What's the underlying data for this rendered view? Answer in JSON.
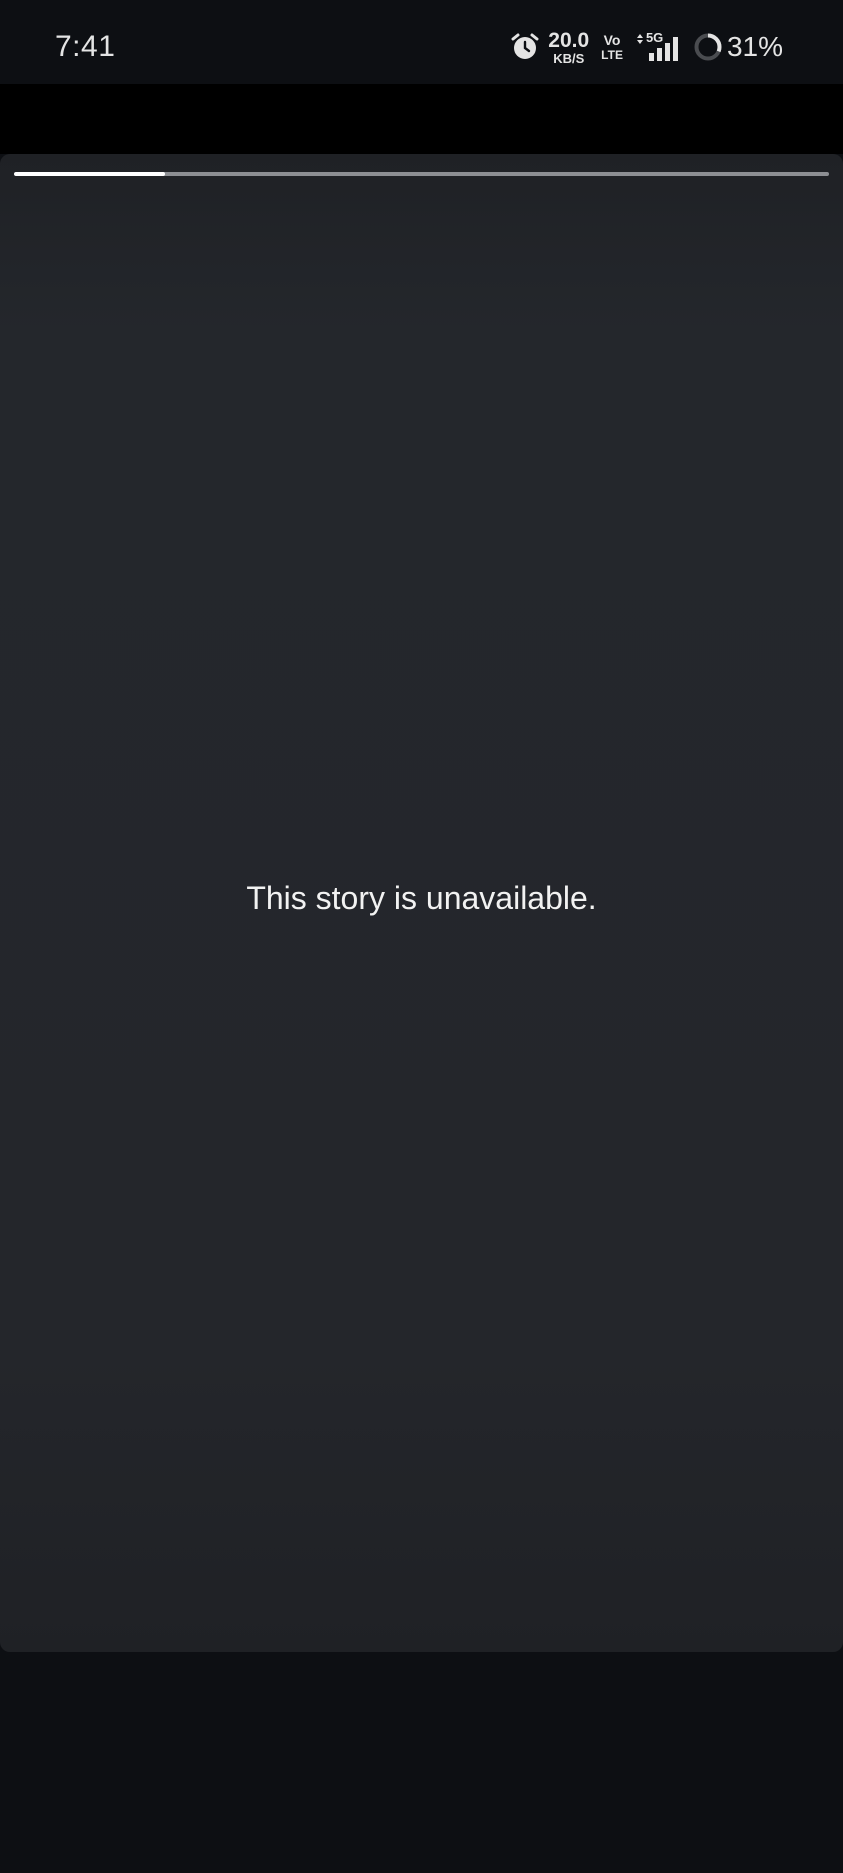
{
  "status_bar": {
    "time": "7:41",
    "alarm_icon": "alarm-clock-icon",
    "net_speed_value": "20.0",
    "net_speed_unit": "KB/S",
    "volte_top": "Vo",
    "volte_bottom": "LTE",
    "network_type": "5G",
    "signal_icon": "cell-signal-icon",
    "battery_icon": "battery-ring-icon",
    "battery_percent": "31%",
    "battery_level": 0.31
  },
  "story": {
    "progress": 0.185,
    "message": "This story is unavailable."
  },
  "colors": {
    "background": "#0d0f13",
    "card": "#24262b",
    "text": "#f2f2f2",
    "progress_track": "#8d8f93",
    "progress_fill": "#ffffff"
  }
}
